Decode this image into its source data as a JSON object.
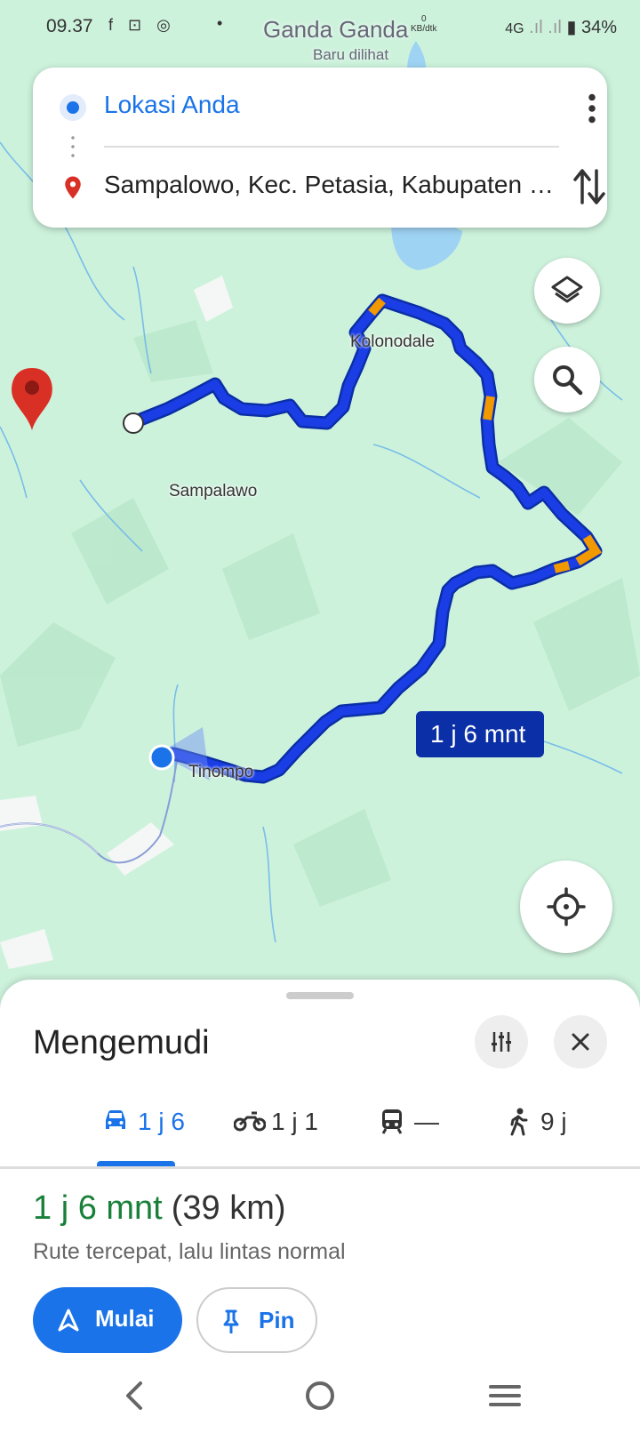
{
  "status_bar": {
    "time": "09.37",
    "app_icons": "f ⊡ ◎",
    "dot": "•",
    "net_speed": "0",
    "net_unit": "KB/dtk",
    "network": "4G",
    "battery": "34%"
  },
  "map_header": {
    "title": "Ganda Ganda",
    "subtitle": "Baru dilihat"
  },
  "directions": {
    "origin": "Lokasi Anda",
    "destination": "Sampalowo, Kec. Petasia, Kabupaten Morowali Utara"
  },
  "map": {
    "places": [
      "Kolonodale",
      "Sampalawo",
      "Tinompo"
    ],
    "route_color": "#1a3de6",
    "route_border": "#0a2fa6",
    "traffic_color": "#f29900",
    "eta_label": "1 j 6 mnt",
    "pin_color": "#d93025"
  },
  "sheet": {
    "title": "Mengemudi",
    "tabs": [
      {
        "icon": "car-icon",
        "label": "1 j 6"
      },
      {
        "icon": "motorcycle-icon",
        "label": "1 j 1"
      },
      {
        "icon": "transit-icon",
        "label": "—"
      },
      {
        "icon": "walk-icon",
        "label": "9 j"
      }
    ],
    "duration": "1 j 6 mnt",
    "distance": "(39 km)",
    "description": "Rute tercepat, lalu lintas normal",
    "start_label": "Mulai",
    "pin_label": "Pin"
  },
  "colors": {
    "accent": "#1a73e8",
    "green": "#188038",
    "map_bg": "#cdf2dc"
  }
}
